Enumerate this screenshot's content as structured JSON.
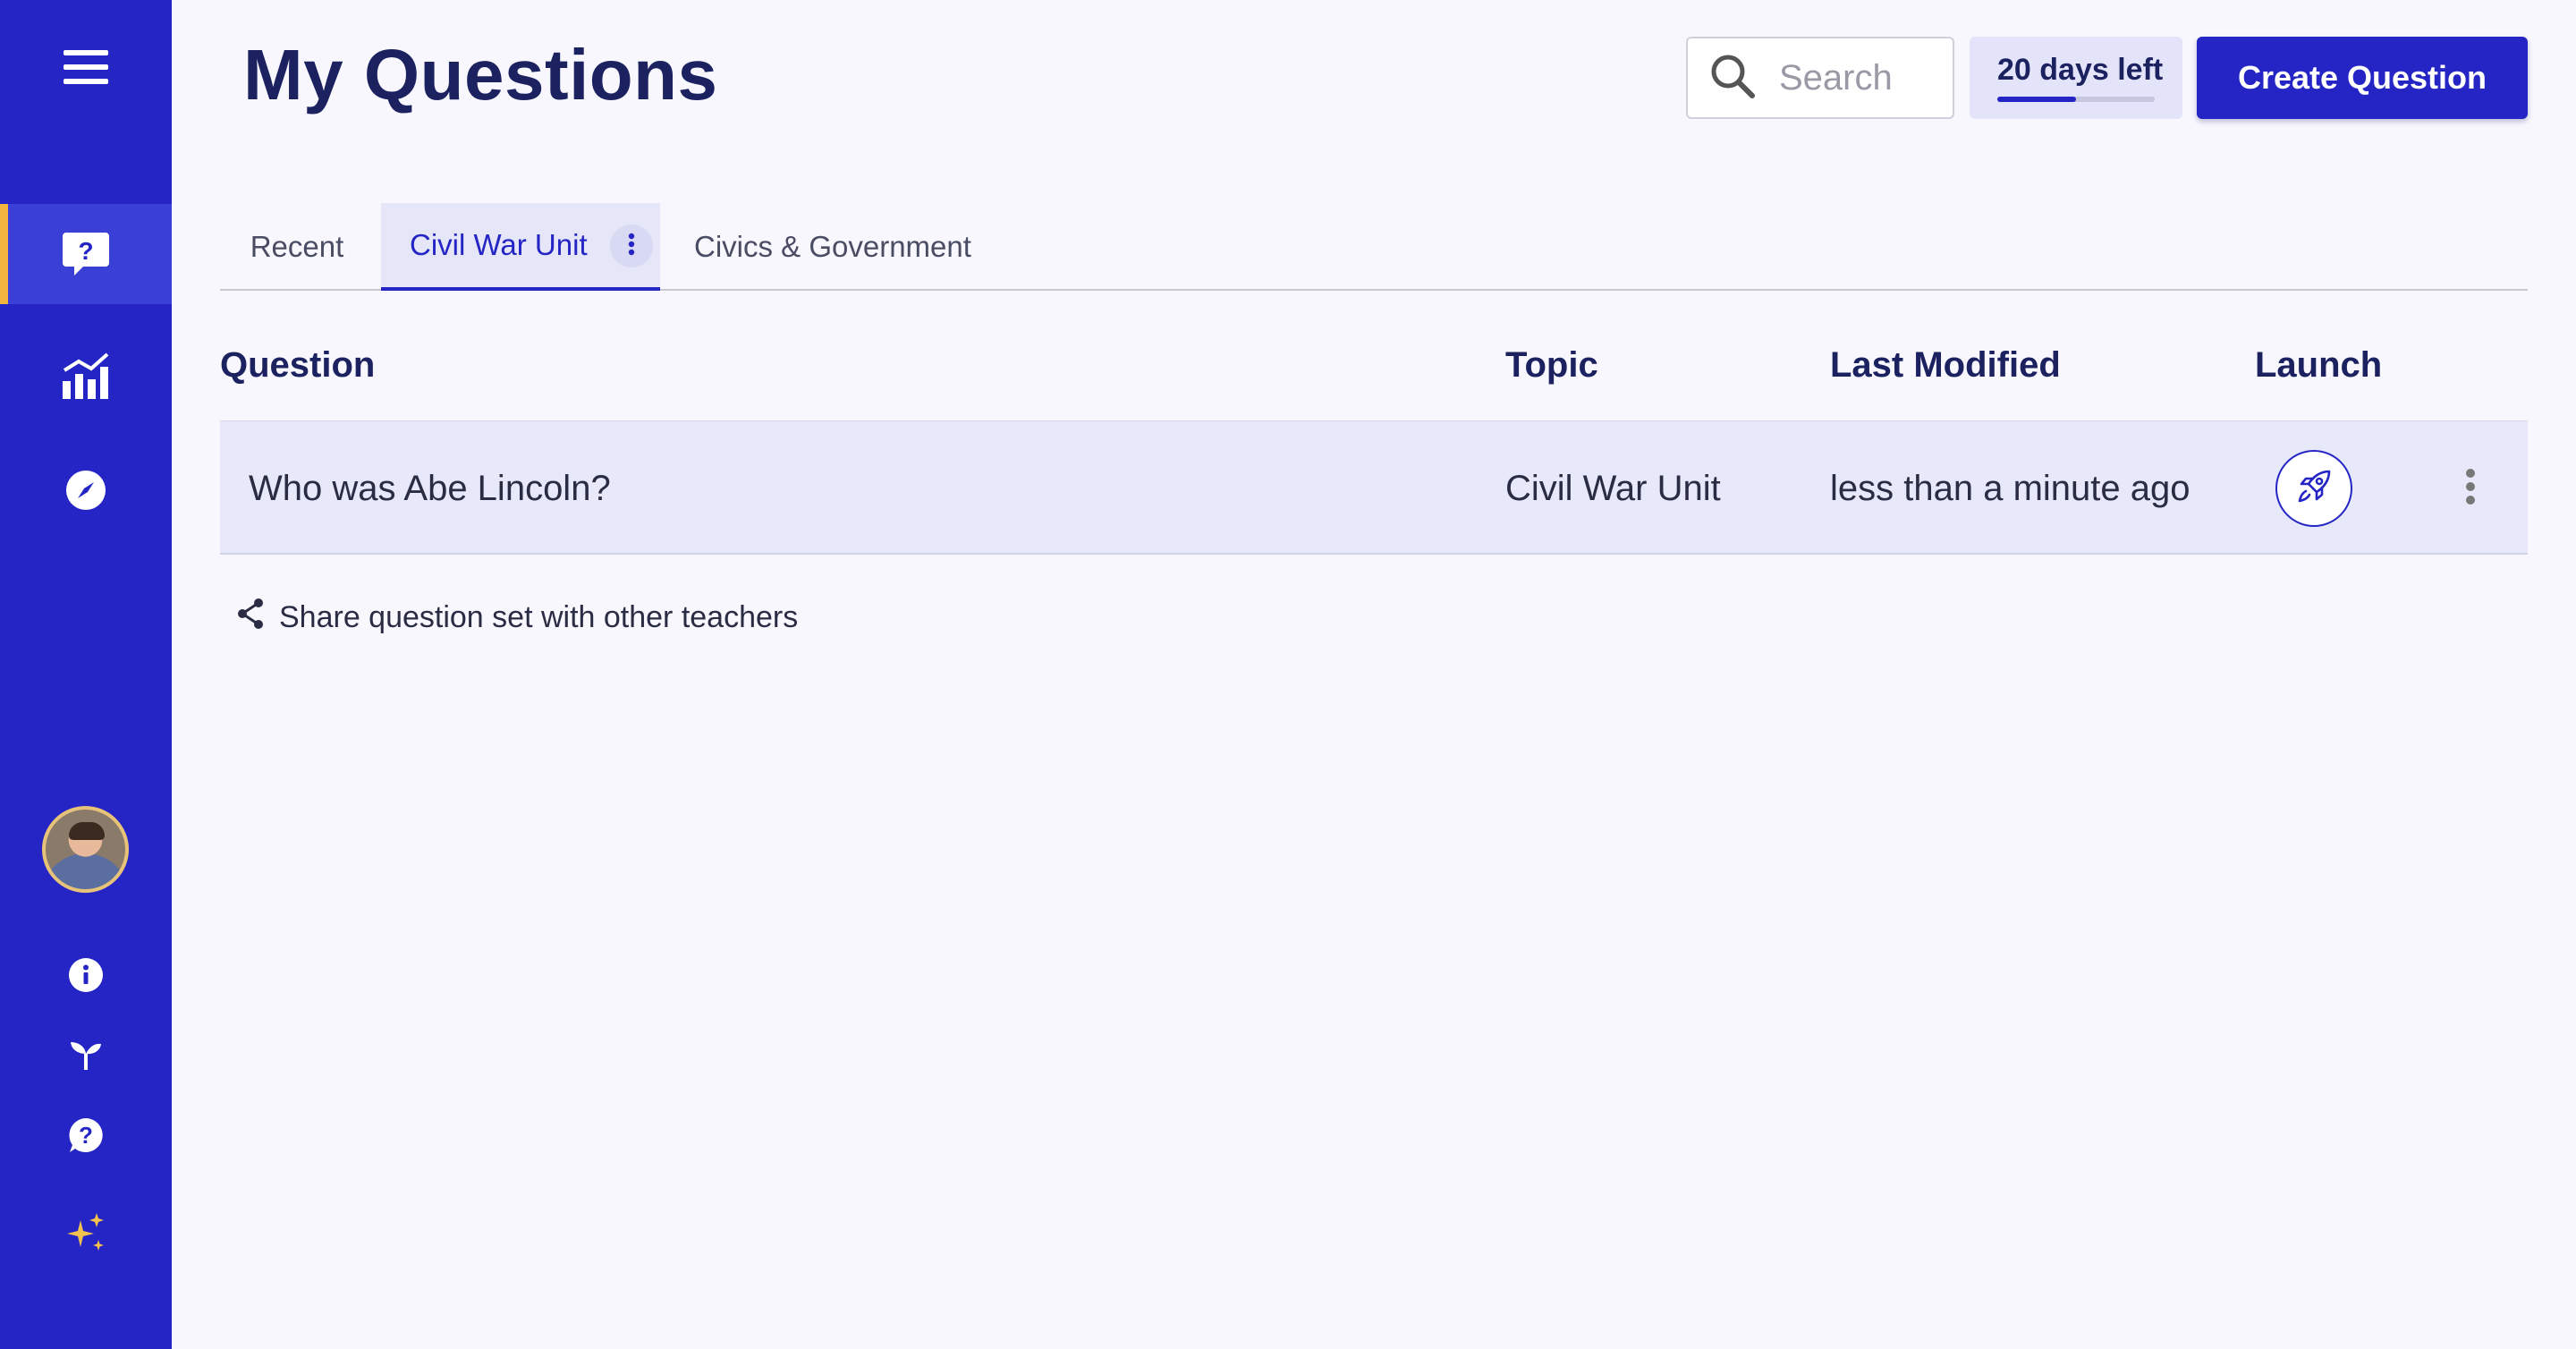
{
  "app": {
    "page_title": "My Questions"
  },
  "sidebar": {
    "items": [
      {
        "name": "menu-icon"
      },
      {
        "name": "questions-icon",
        "active": true
      },
      {
        "name": "reports-icon"
      },
      {
        "name": "compass-icon"
      },
      {
        "name": "avatar"
      },
      {
        "name": "info-icon"
      },
      {
        "name": "sprout-icon"
      },
      {
        "name": "help-icon"
      },
      {
        "name": "sparkles-icon"
      }
    ],
    "accent": "#f2b640",
    "background": "#2425c4"
  },
  "header": {
    "search_placeholder": "Search",
    "trial_label": "20 days left",
    "trial_progress": 0.5,
    "create_button": "Create Question"
  },
  "tabs": [
    {
      "label": "Recent",
      "active": false
    },
    {
      "label": "Civil War Unit",
      "active": true
    },
    {
      "label": "Civics & Government",
      "active": false
    }
  ],
  "table": {
    "headers": {
      "question": "Question",
      "topic": "Topic",
      "last_modified": "Last Modified",
      "launch": "Launch"
    },
    "rows": [
      {
        "question": "Who was Abe Lincoln?",
        "topic": "Civil War Unit",
        "last_modified": "less than a minute ago"
      }
    ]
  },
  "share_link": "Share question set with other teachers",
  "colors": {
    "brand": "#2425c4",
    "title": "#1c2160",
    "row_bg": "#e7e8fa",
    "page_bg": "#f7f7fd"
  }
}
